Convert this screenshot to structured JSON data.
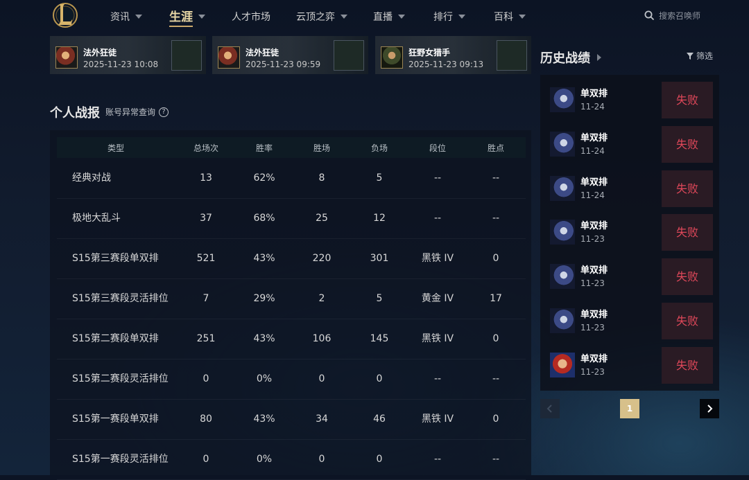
{
  "nav": {
    "items": [
      {
        "label": "资讯",
        "caret": true,
        "active": false
      },
      {
        "label": "生涯",
        "caret": true,
        "active": true
      },
      {
        "label": "人才市场",
        "caret": false,
        "active": false
      },
      {
        "label": "云顶之弈",
        "caret": true,
        "active": false
      },
      {
        "label": "直播",
        "caret": true,
        "active": false
      },
      {
        "label": "排行",
        "caret": true,
        "active": false
      },
      {
        "label": "百科",
        "caret": true,
        "active": false
      }
    ],
    "search_placeholder": "搜索召唤师"
  },
  "videos": [
    {
      "title": "法外狂徒",
      "time": "2025-11-23 10:08"
    },
    {
      "title": "法外狂徒",
      "time": "2025-11-23 09:59"
    },
    {
      "title": "狂野女猎手",
      "time": "2025-11-23 09:13"
    }
  ],
  "stats": {
    "title": "个人战报",
    "abnormal_link": "账号异常查询",
    "help_glyph": "?",
    "columns": [
      "类型",
      "总场次",
      "胜率",
      "胜场",
      "负场",
      "段位",
      "胜点"
    ],
    "rows": [
      [
        "经典对战",
        "13",
        "62%",
        "8",
        "5",
        "--",
        "--"
      ],
      [
        "极地大乱斗",
        "37",
        "68%",
        "25",
        "12",
        "--",
        "--"
      ],
      [
        "S15第三赛段单双排",
        "521",
        "43%",
        "220",
        "301",
        "黑铁 IV",
        "0"
      ],
      [
        "S15第三赛段灵活排位",
        "7",
        "29%",
        "2",
        "5",
        "黄金 IV",
        "17"
      ],
      [
        "S15第二赛段单双排",
        "251",
        "43%",
        "106",
        "145",
        "黑铁 IV",
        "0"
      ],
      [
        "S15第二赛段灵活排位",
        "0",
        "0%",
        "0",
        "0",
        "--",
        "--"
      ],
      [
        "S15第一赛段单双排",
        "80",
        "43%",
        "34",
        "46",
        "黑铁 IV",
        "0"
      ],
      [
        "S15第一赛段灵活排位",
        "0",
        "0%",
        "0",
        "0",
        "--",
        "--"
      ]
    ]
  },
  "history": {
    "title": "历史战绩",
    "filter_label": "筛选",
    "matches": [
      {
        "mode": "单双排",
        "date": "11-24",
        "result": "失败",
        "avatar": "blue-champion"
      },
      {
        "mode": "单双排",
        "date": "11-24",
        "result": "失败",
        "avatar": "blue-champion"
      },
      {
        "mode": "单双排",
        "date": "11-24",
        "result": "失败",
        "avatar": "blue-champion"
      },
      {
        "mode": "单双排",
        "date": "11-23",
        "result": "失败",
        "avatar": "blue-champion"
      },
      {
        "mode": "单双排",
        "date": "11-23",
        "result": "失败",
        "avatar": "blue-champion"
      },
      {
        "mode": "单双排",
        "date": "11-23",
        "result": "失败",
        "avatar": "blue-champion"
      },
      {
        "mode": "单双排",
        "date": "11-23",
        "result": "失败",
        "avatar": "red-champion"
      }
    ],
    "pagination": {
      "current": "1"
    }
  },
  "colors": {
    "accent_gold": "#c9a86a",
    "defeat_red": "#e0485a",
    "page_active": "#d7c08a"
  }
}
